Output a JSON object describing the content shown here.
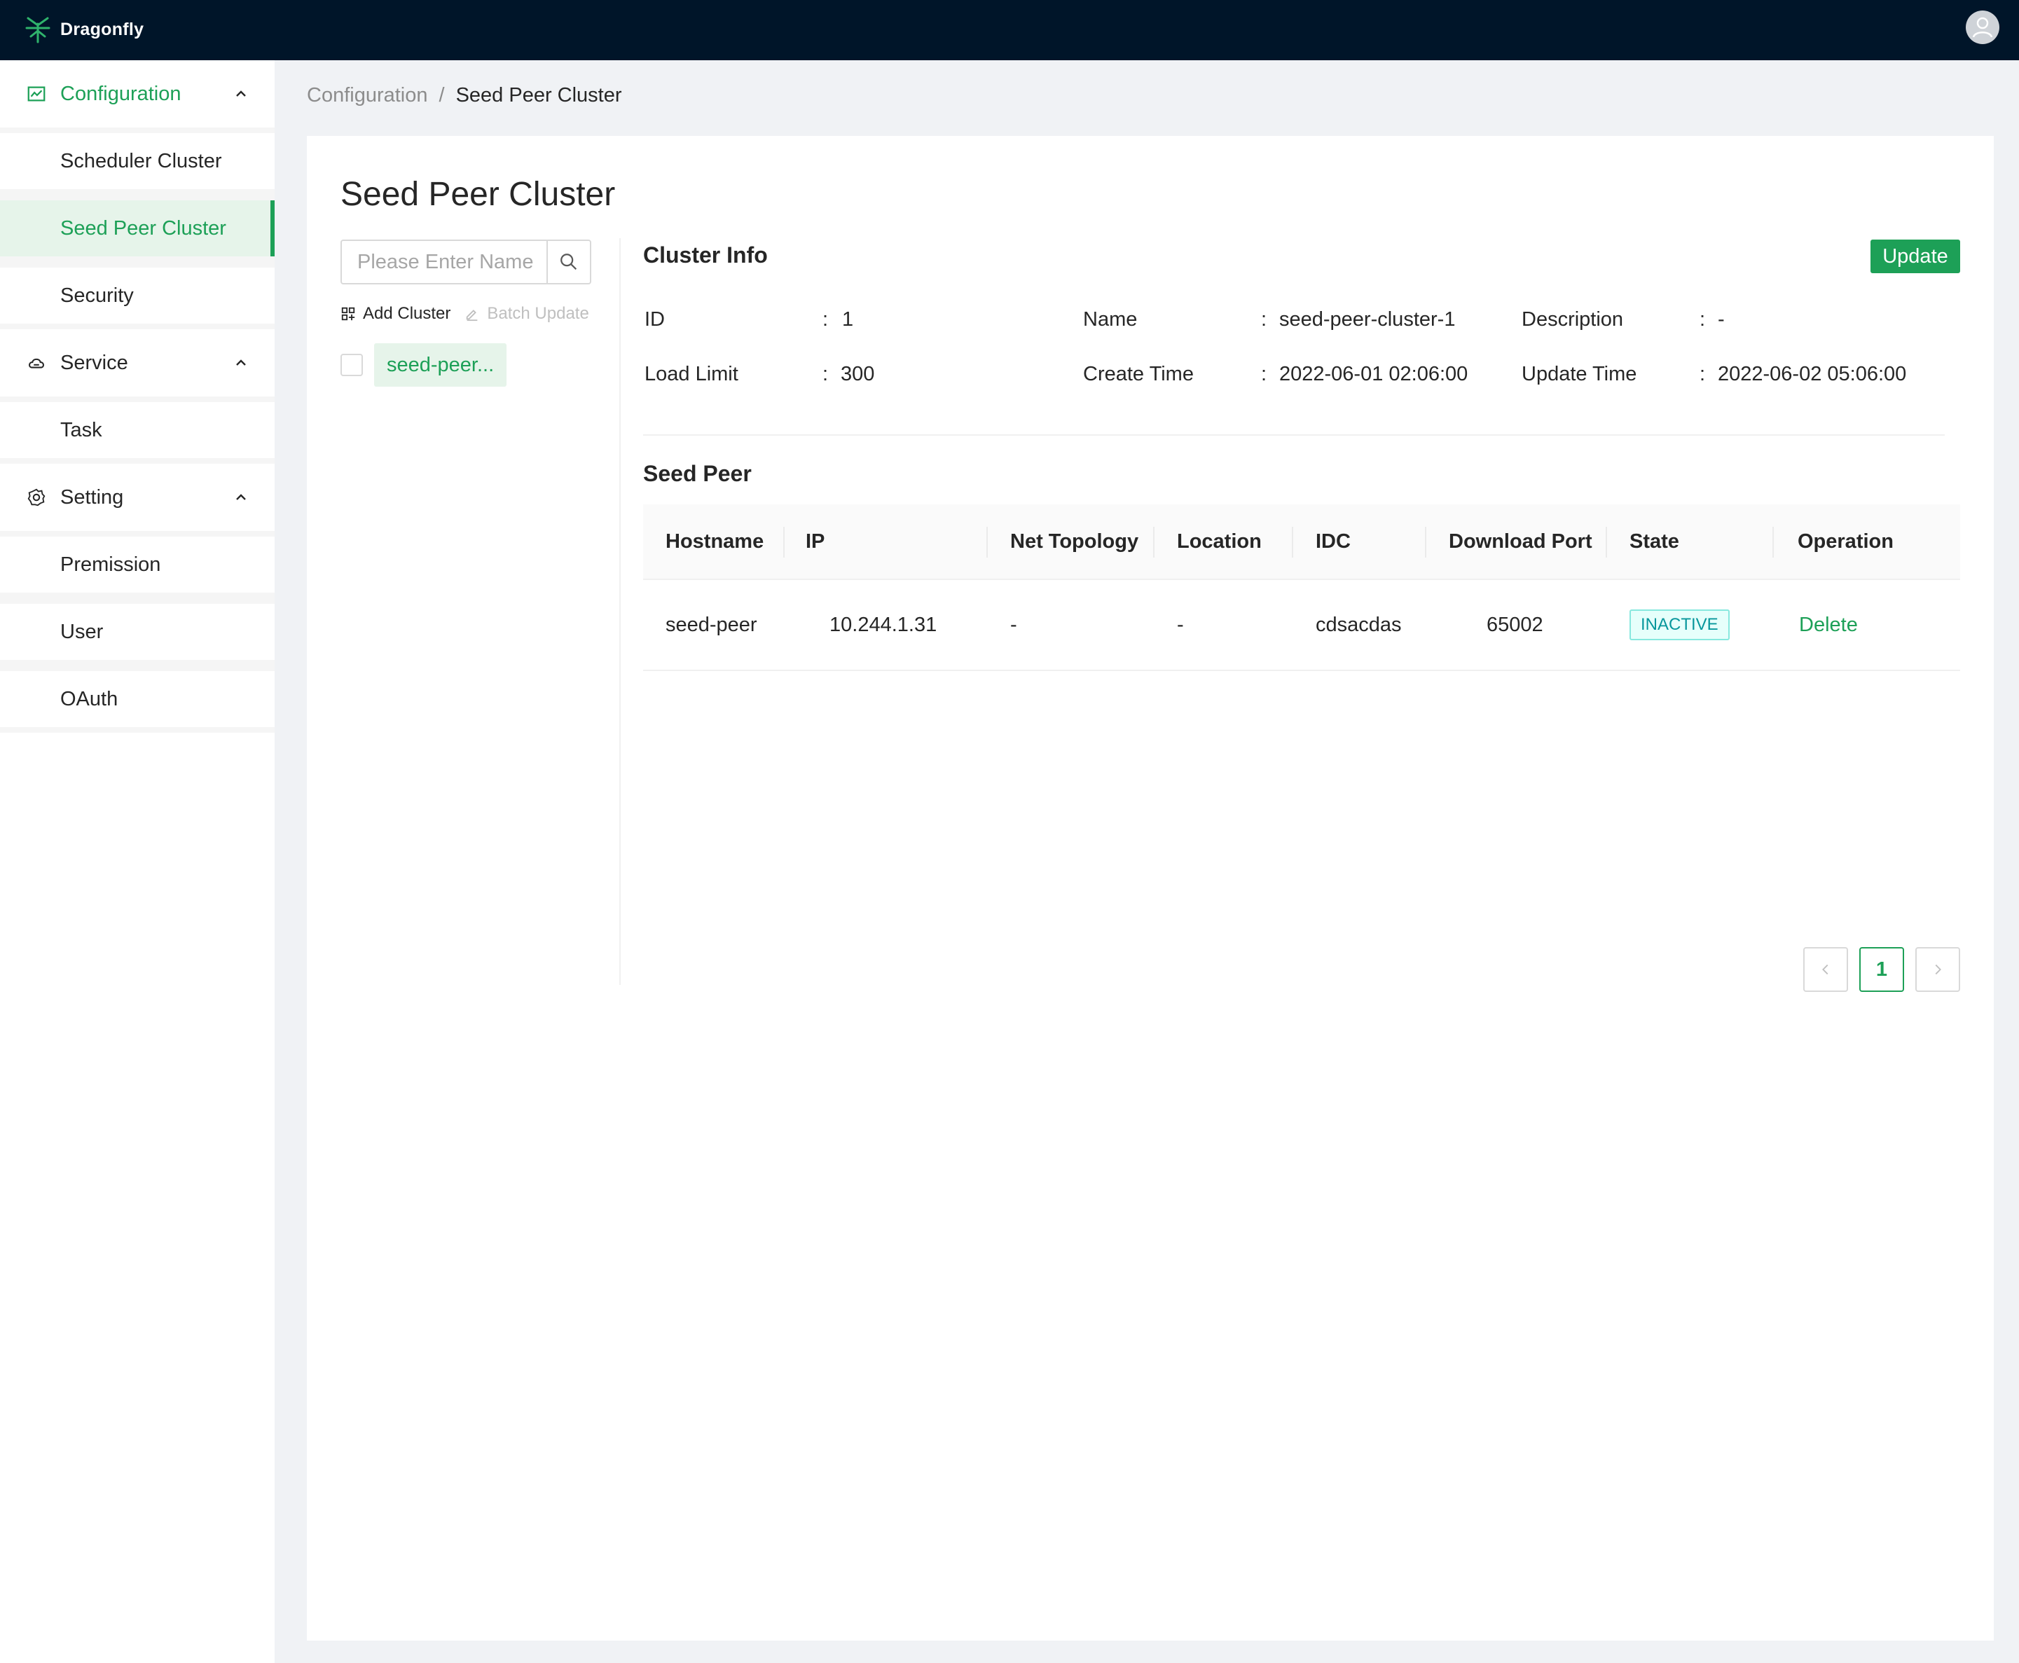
{
  "app": {
    "name": "Dragonfly"
  },
  "sidebar": {
    "groups": [
      {
        "label": "Configuration",
        "icon": "chart-icon",
        "items": [
          "Scheduler Cluster",
          "Seed Peer Cluster",
          "Security"
        ]
      },
      {
        "label": "Service",
        "icon": "cloud-icon",
        "items": [
          "Task"
        ]
      },
      {
        "label": "Setting",
        "icon": "gear-icon",
        "items": [
          "Premission",
          "User",
          "OAuth"
        ]
      }
    ],
    "selected": "Seed Peer Cluster"
  },
  "breadcrumb": {
    "parent": "Configuration",
    "separator": "/",
    "current": "Seed Peer Cluster"
  },
  "page": {
    "title": "Seed Peer Cluster"
  },
  "cluster_list": {
    "search_placeholder": "Please Enter Name",
    "add_label": "Add Cluster",
    "batch_label": "Batch Update",
    "items": [
      "seed-peer..."
    ]
  },
  "cluster_info": {
    "title": "Cluster Info",
    "update_label": "Update",
    "fields": {
      "id": {
        "label": "ID",
        "value": "1"
      },
      "name": {
        "label": "Name",
        "value": "seed-peer-cluster-1"
      },
      "description": {
        "label": "Description",
        "value": "-"
      },
      "load_limit": {
        "label": "Load Limit",
        "value": "300"
      },
      "create_time": {
        "label": "Create Time",
        "value": "2022-06-01 02:06:00"
      },
      "update_time": {
        "label": "Update Time",
        "value": "2022-06-02 05:06:00"
      }
    },
    "colon": ":"
  },
  "seed_peer": {
    "title": "Seed Peer",
    "columns": [
      "Hostname",
      "IP",
      "Net Topology",
      "Location",
      "IDC",
      "Download Port",
      "State",
      "Operation"
    ],
    "rows": [
      {
        "hostname": "seed-peer",
        "ip": "10.244.1.31",
        "net_topology": "-",
        "location": "-",
        "idc": "cdsacdas",
        "download_port": "65002",
        "state": "INACTIVE",
        "operation": "Delete"
      }
    ]
  },
  "pagination": {
    "current": "1",
    "prev": "<",
    "next": ">"
  },
  "colors": {
    "accent": "#1da057",
    "topbar": "#001529",
    "state_inactive": "#08979c"
  }
}
